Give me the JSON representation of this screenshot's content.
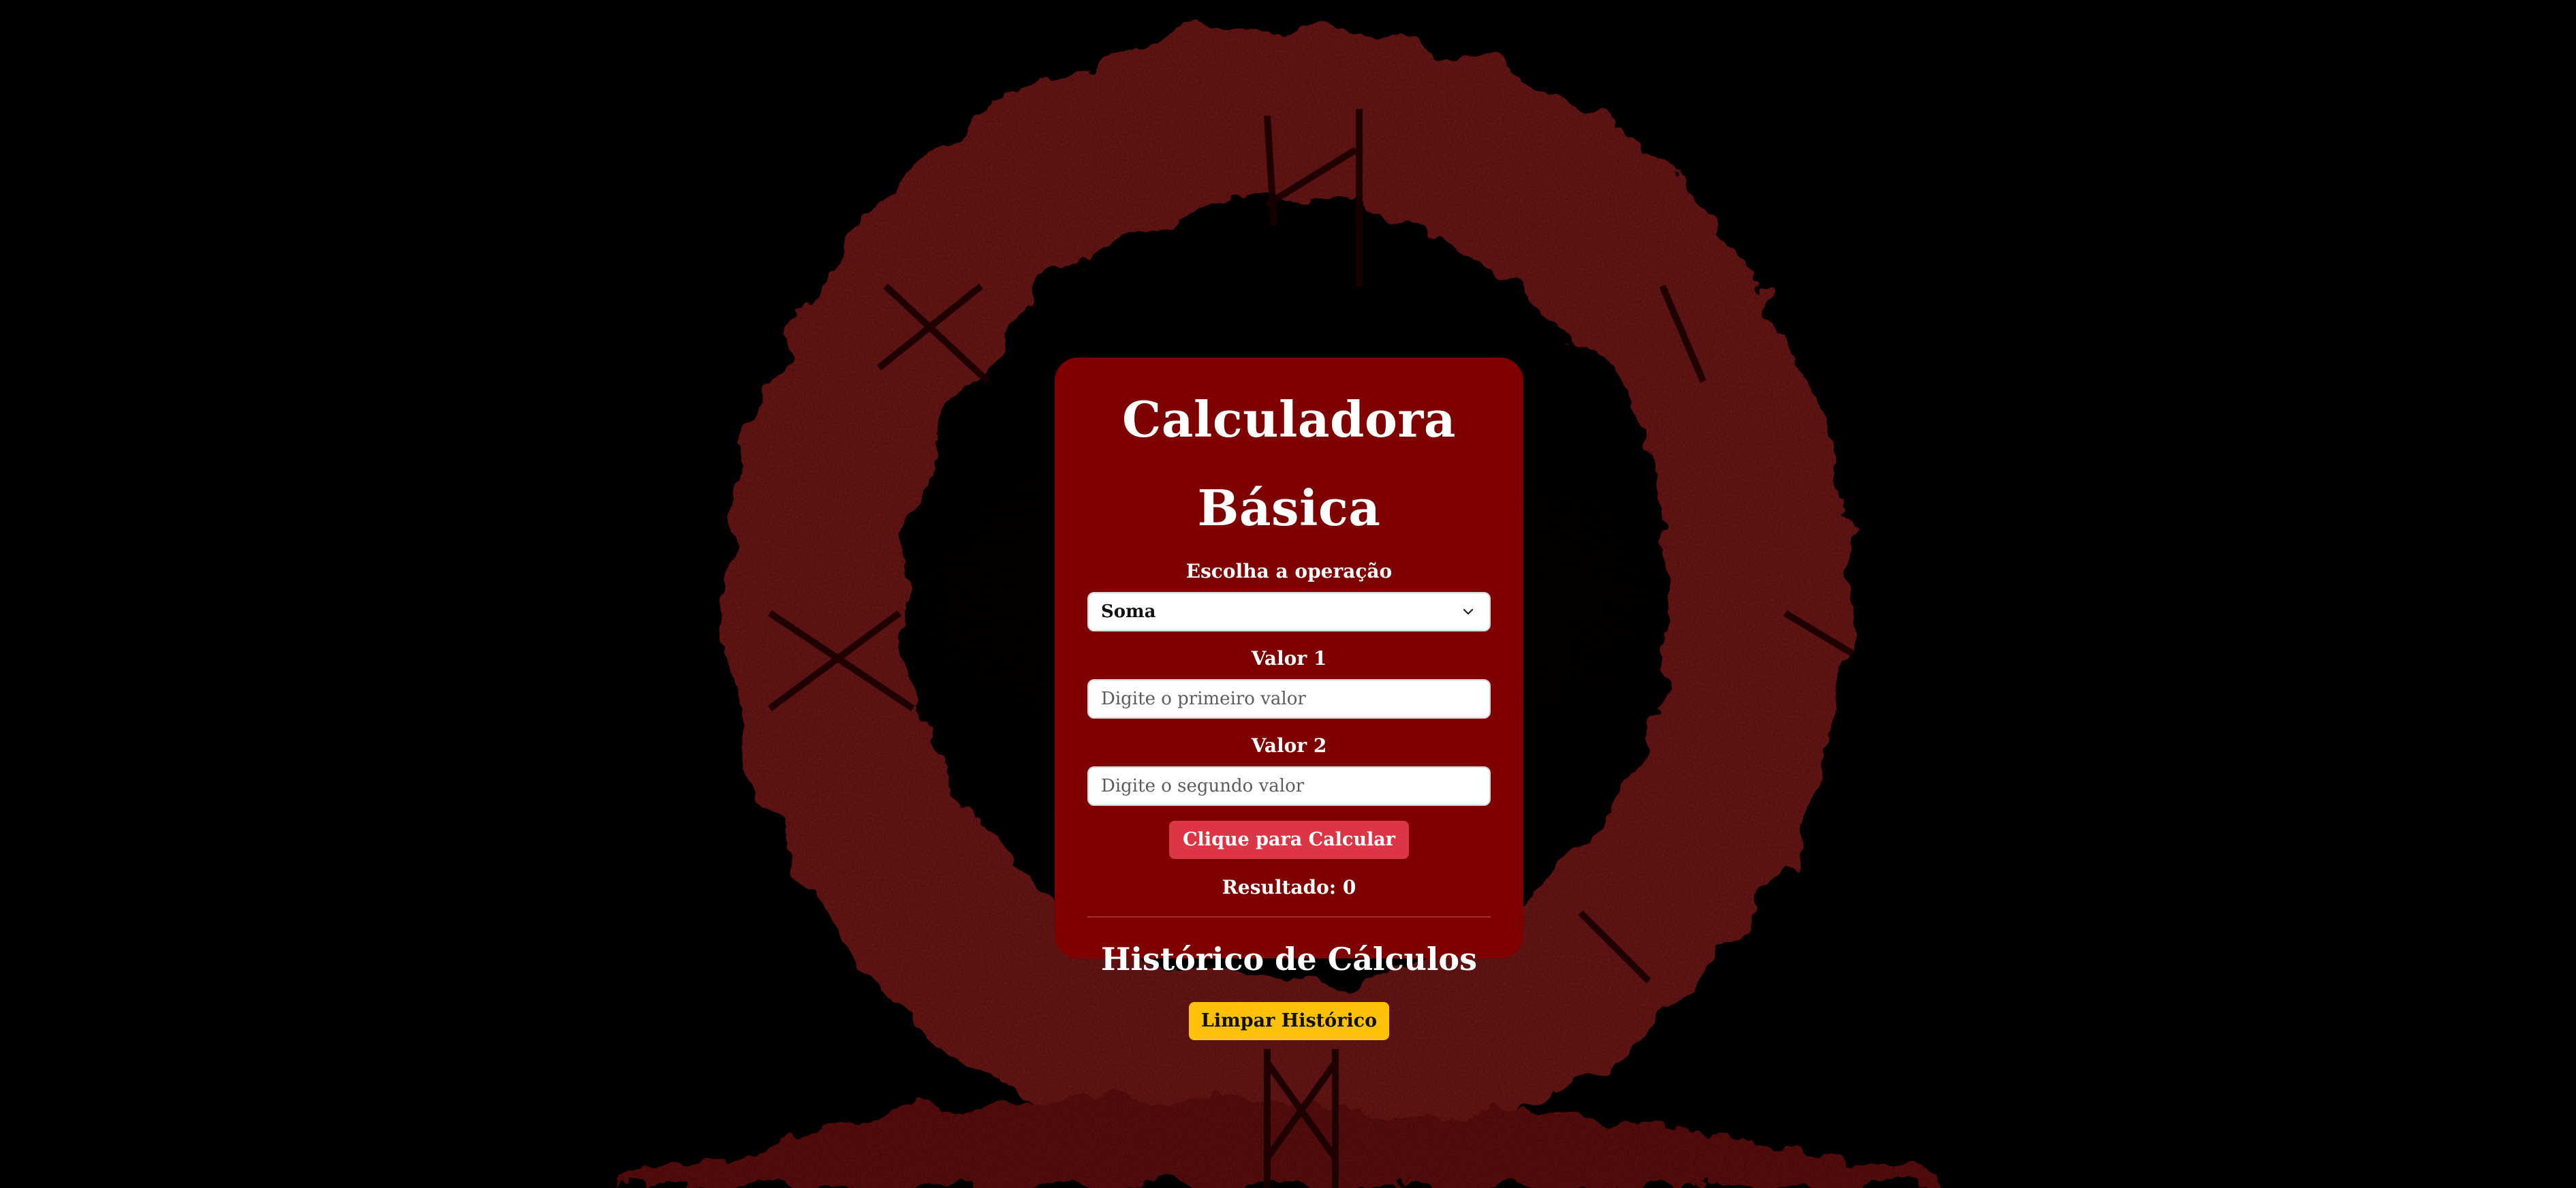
{
  "calculator": {
    "title": "Calculadora Básica",
    "operation_label": "Escolha a operação",
    "operation_selected": "Soma",
    "value1_label": "Valor 1",
    "value1_placeholder": "Digite o primeiro valor",
    "value2_label": "Valor 2",
    "value2_placeholder": "Digite o segundo valor",
    "calculate_button": "Clique para Calcular",
    "result_text": "Resultado: 0",
    "history_title": "Histórico de Cálculos",
    "clear_history_button": "Limpar Histórico"
  },
  "icons": {
    "select_arrow": "chevron-down-icon"
  },
  "colors": {
    "card_background": "#7f0000",
    "calculate_button": "#dc3545",
    "clear_button": "#ffc107",
    "page_background": "#000000",
    "art_red": "#6e1313"
  }
}
